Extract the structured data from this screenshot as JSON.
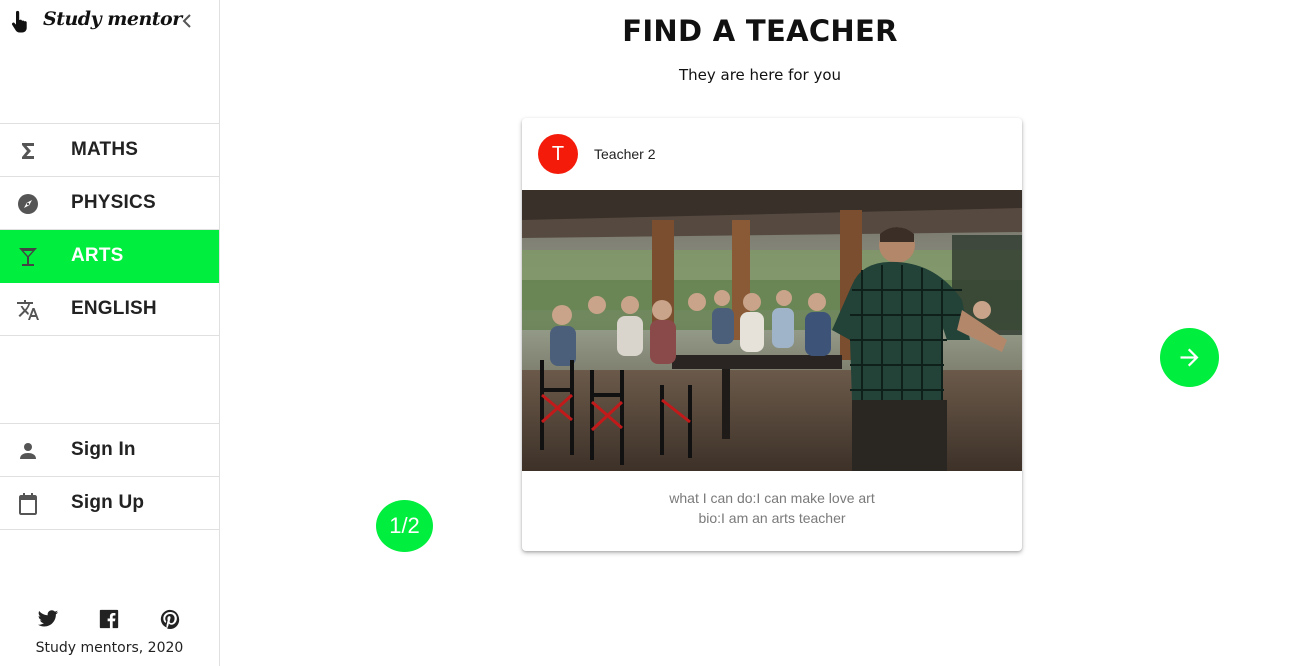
{
  "brand": {
    "name": "Study mentor"
  },
  "nav": {
    "items": [
      {
        "label": "MATHS",
        "icon": "sigma-icon",
        "active": false
      },
      {
        "label": "PHYSICS",
        "icon": "compass-icon",
        "active": false
      },
      {
        "label": "ARTS",
        "icon": "cocktail-icon",
        "active": true
      },
      {
        "label": "ENGLISH",
        "icon": "translate-icon",
        "active": false
      }
    ]
  },
  "auth": {
    "sign_in": "Sign In",
    "sign_up": "Sign Up"
  },
  "social": {
    "icons": [
      "twitter-icon",
      "facebook-icon",
      "pinterest-icon"
    ]
  },
  "footer": {
    "text": "Study mentors, 2020"
  },
  "main": {
    "title": "FIND A TEACHER",
    "subtitle": "They are here for you"
  },
  "card": {
    "avatar_letter": "T",
    "name": "Teacher 2",
    "what_i_can_do": "what I can do:I can make love art",
    "bio": "bio:I am an arts teacher"
  },
  "pager": {
    "counter": "1/2"
  },
  "colors": {
    "accent": "#00ee3d",
    "avatar": "#f41b0b"
  }
}
